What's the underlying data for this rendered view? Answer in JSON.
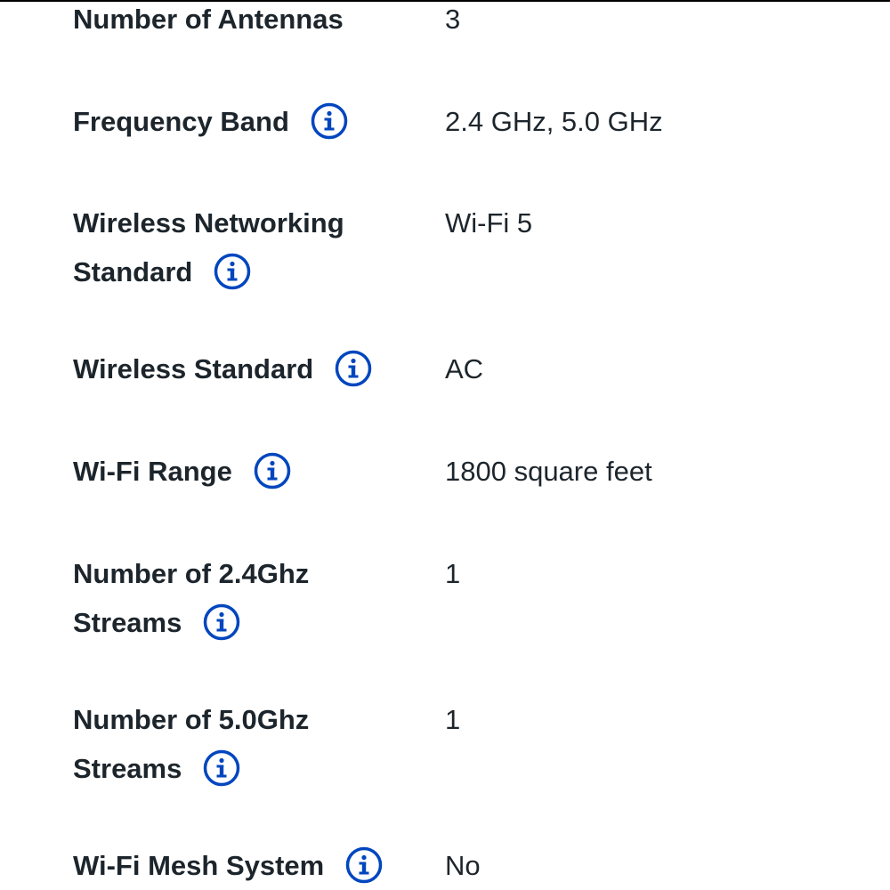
{
  "colors": {
    "text": "#1d252c",
    "info_icon": "#0046be",
    "background": "#ffffff"
  },
  "specs": [
    {
      "label_line1": "Number of Antennas",
      "label_line2": "",
      "value": "3",
      "has_info": false
    },
    {
      "label_line1": "Frequency Band",
      "label_line2": "",
      "value": "2.4 GHz, 5.0 GHz",
      "has_info": true
    },
    {
      "label_line1": "Wireless Networking",
      "label_line2": "Standard",
      "value": "Wi-Fi 5",
      "has_info": true
    },
    {
      "label_line1": "Wireless Standard",
      "label_line2": "",
      "value": "AC",
      "has_info": true
    },
    {
      "label_line1": "Wi-Fi Range",
      "label_line2": "",
      "value": "1800 square feet",
      "has_info": true
    },
    {
      "label_line1": "Number of 2.4Ghz",
      "label_line2": "Streams",
      "value": "1",
      "has_info": true
    },
    {
      "label_line1": "Number of 5.0Ghz",
      "label_line2": "Streams",
      "value": "1",
      "has_info": true
    },
    {
      "label_line1": "Wi-Fi Mesh System",
      "label_line2": "",
      "value": "No",
      "has_info": true
    }
  ]
}
